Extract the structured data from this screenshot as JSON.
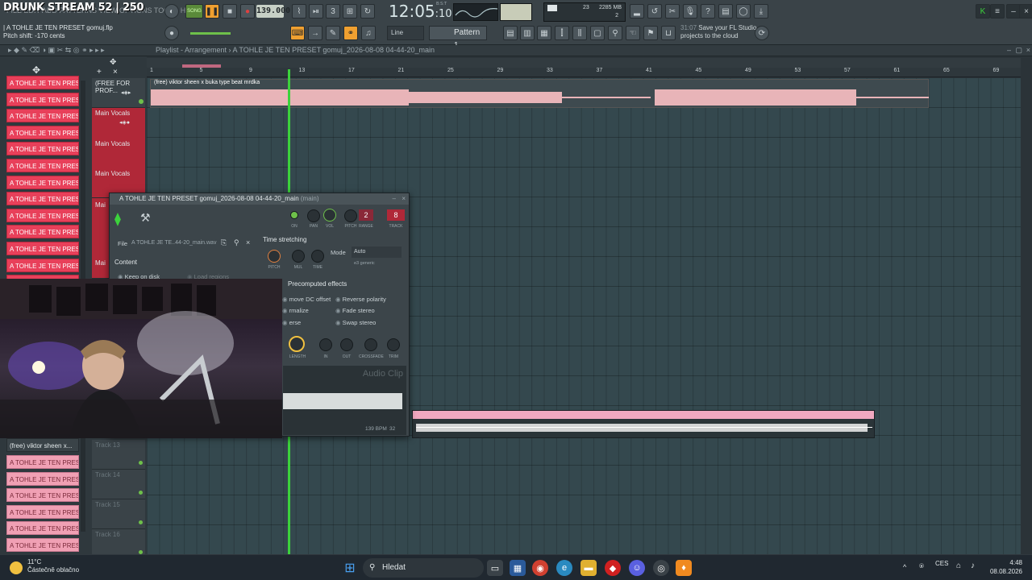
{
  "stream": {
    "title": "DRUNK STREAM 52 | 250"
  },
  "menu": {
    "items_text": "FILE EDIT ADD PATTERNS VIEW OPTIONS TOOLS HELP"
  },
  "hint": {
    "line1": "| A TOHLE JE TEN PRESET gomuj.flp",
    "line2": "Pitch shift: -170 cents"
  },
  "transport": {
    "song_label": "SONG",
    "tempo": "139.000",
    "clock_main": "12:05",
    "clock_sub": ":10",
    "clock_unit": "B:S:T"
  },
  "cpu": {
    "memory": "2285 MB",
    "voices": "23",
    "value2": "2"
  },
  "toolbar": {
    "snap": "Line",
    "pattern": "Pattern 1"
  },
  "news": {
    "time": "31:07",
    "text": "Save your FL Studio projects to the cloud"
  },
  "breadcrumb": {
    "text": "Playlist - Arrangement  ›  A TOHLE JE TEN PRESET gomuj_2026-08-08 04-44-20_main"
  },
  "ruler": {
    "marks": [
      "1",
      "5",
      "9",
      "13",
      "17",
      "21",
      "25",
      "29",
      "33",
      "37",
      "41",
      "45",
      "49",
      "53",
      "57",
      "61",
      "65",
      "69"
    ]
  },
  "browser": {
    "red_items": [
      "A TOHLE JE TEN PRESET g...",
      "A TOHLE JE TEN PRESET g...",
      "A TOHLE JE TEN PRESET g...",
      "A TOHLE JE TEN PRESET g...",
      "A TOHLE JE TEN PRESET g...",
      "A TOHLE JE TEN PRESET g...",
      "A TOHLE JE TEN PRESET g...",
      "A TOHLE JE TEN PRESET g...",
      "A TOHLE JE TEN PRESET g...",
      "A TOHLE JE TEN PRESET g...",
      "A TOHLE JE TEN PRESET g...",
      "A TOHLE JE TEN PRESET g...",
      "A TOHLE JE TEN PRESET g..."
    ],
    "beat_item": "(free) viktor sheen x...",
    "light_items": [
      "A TOHLE JE TEN PRESET g...",
      "A TOHLE JE TEN PRESET g...",
      "A TOHLE JE TEN PRESET g...",
      "A TOHLE JE TEN PRESET g...",
      "A TOHLE JE TEN PRESET g...",
      "A TOHLE JE TEN PRESET g..."
    ]
  },
  "tracks": {
    "beat_head": "(FREE FOR PROF...",
    "beat_clip": "(free) viktor sheen x buka type beat mrdka",
    "vocal_head": "Main Vocals",
    "vocal_lane": [
      "Main Vocals",
      "Main Vocals",
      "Mai",
      "Mai"
    ],
    "empty": [
      "Track 13",
      "Track 14",
      "Track 15",
      "Track 16"
    ]
  },
  "dialog": {
    "title": "A TOHLE JE TEN PRESET gomuj_2026-08-08 04-44-20_main",
    "title_suffix": "(main)",
    "knobs": {
      "on": "ON",
      "pan": "PAN",
      "vol": "VOL",
      "pitch": "PITCH",
      "range": "RANGE",
      "track": "TRACK"
    },
    "range_value": "2",
    "track_value": "8",
    "file_label": "File",
    "file_name": "A TOHLE JE TE..44-20_main.wav",
    "content_label": "Content",
    "keep_on_disk": "Keep on disk",
    "load_regions": "Load regions",
    "time_stretching": "Time stretching",
    "ts_knobs": {
      "pitch": "PITCH",
      "mul": "MUL",
      "time": "TIME"
    },
    "mode_label": "Mode",
    "mode_value": "Auto",
    "mode_sub": "e3 generic",
    "precomputed": "Precomputed effects",
    "effects_left": [
      "move DC offset",
      "rmalize",
      "erse"
    ],
    "effects_right": [
      "Reverse polarity",
      "Fade stereo",
      "Swap stereo"
    ],
    "fx_knobs": {
      "length": "LENGTH",
      "in": "IN",
      "out": "OUT",
      "crossfade": "CROSSFADE",
      "trim": "TRIM"
    },
    "watermark": "Audio Clip",
    "bpm": "139 BPM",
    "bpm_sub": "32"
  },
  "taskbar": {
    "weather_temp": "11°C",
    "weather_desc": "Částečně oblačno",
    "search": "Hledat",
    "lang": "CES",
    "time": "4:48",
    "date": "08.08.2026"
  },
  "colors": {
    "accent": "#f0a030",
    "playhead": "#3cd23c",
    "clip_red": "#e8405a",
    "clip_pink": "#f0a8c0"
  }
}
